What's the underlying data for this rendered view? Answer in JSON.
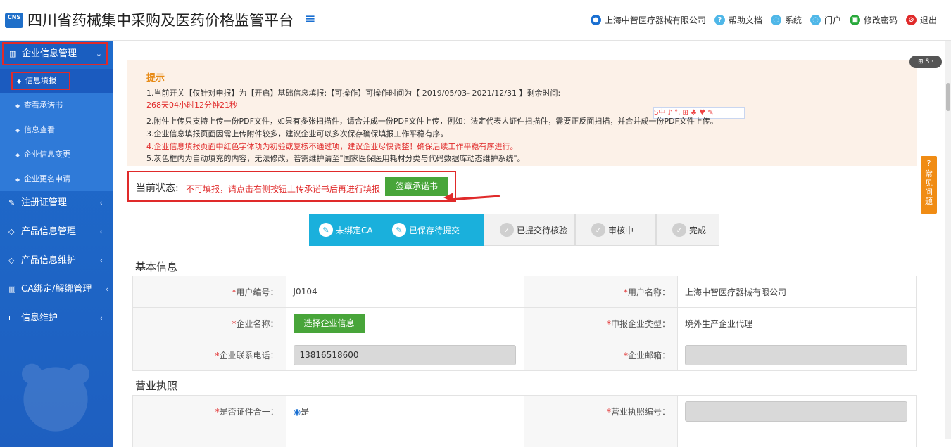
{
  "header": {
    "logo_text": "CNS",
    "title": "四川省药械集中采购及医药价格监管平台",
    "menu_icon": "≡",
    "nav": [
      {
        "label": "上海中智医疗器械有限公司",
        "icon": "user-icon",
        "color": "#1a6fd1"
      },
      {
        "label": "帮助文档",
        "icon": "help-icon",
        "color": "#4fb7e8"
      },
      {
        "label": "系统",
        "icon": "system-icon",
        "color": "#4fb7e8"
      },
      {
        "label": "门户",
        "icon": "portal-icon",
        "color": "#4fb7e8"
      },
      {
        "label": "修改密码",
        "icon": "lock-icon",
        "color": "#27a83a"
      },
      {
        "label": "退出",
        "icon": "logout-icon",
        "color": "#e02a2a"
      }
    ]
  },
  "sidebar": {
    "active_menu": "企业信息管理",
    "submenu": [
      "信息填报",
      "查看承诺书",
      "信息查看",
      "企业信息变更",
      "企业更名申请"
    ],
    "menus": [
      "注册证管理",
      "产品信息管理",
      "产品信息维护",
      "CA绑定/解绑管理",
      "信息维护"
    ],
    "menu_arrow": "‹"
  },
  "tip": {
    "title": "提示",
    "line1": "1.当前开关【仅针对申报】为【开启】基础信息填报:【可操作】可操作时间为【 2019/05/03- 2021/12/31 】剩余时间:",
    "countdown": "268天04小时12分钟21秒",
    "line2": "2.附件上传只支持上传一份PDF文件，如果有多张扫描件，请合并成一份PDF文件上传，例如：法定代表人证件扫描件，需要正反面扫描，并合并成一份PDF文件上传。",
    "line3": "3.企业信息填报页面因需上传附件较多，建议企业可以多次保存确保填报工作平稳有序。",
    "line4": "4.企业信息填报页面中红色字体项为初验或复核不通过项，建议企业尽快调整！确保后续工作平稳有序进行。",
    "line5": "5.灰色框内为自动填充的内容，无法修改，若需维护请至\"国家医保医用耗材分类与代码数据库动态维护系统\"。",
    "ime_bar": "S中 ♪ °, ⊞ ♣ ♥ ✎"
  },
  "status": {
    "label": "当前状态:",
    "text": "不可填报，请点击右侧按钮上传承诺书后再进行填报",
    "sign_button": "签章承诺书"
  },
  "steps": [
    {
      "label": "未绑定CA",
      "state": "done"
    },
    {
      "label": "已保存待提交",
      "state": "done"
    },
    {
      "label": "已提交待核验",
      "state": "todo"
    },
    {
      "label": "审核中",
      "state": "todo"
    },
    {
      "label": "完成",
      "state": "todo"
    }
  ],
  "basic": {
    "section_title": "基本信息",
    "user_id_label": "用户编号：",
    "user_id": "J0104",
    "user_name_label": "用户名称：",
    "user_name": "上海中智医疗器械有限公司",
    "company_label": "企业名称：",
    "company_button": "选择企业信息",
    "type_label": "申报企业类型：",
    "type_value": "境外生产企业代理",
    "phone_label": "企业联系电话：",
    "phone": "13816518600",
    "email_label": "企业邮箱：",
    "email": ""
  },
  "license": {
    "section_title": "营业执照",
    "merged_label": "是否证件合一：",
    "merged_value": "是",
    "license_no_label": "营业执照编号：",
    "license_no": ""
  },
  "help_tab": "常见问题",
  "help_q": "?"
}
